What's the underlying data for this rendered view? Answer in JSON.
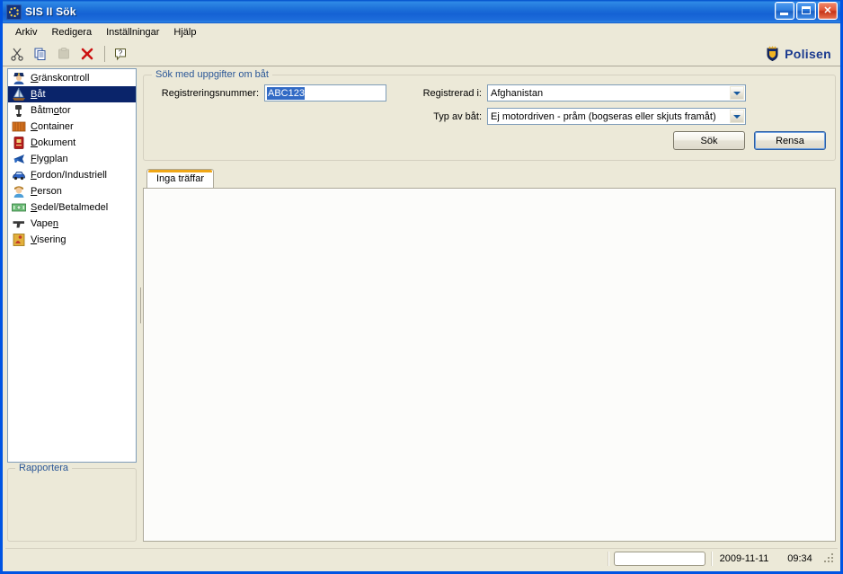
{
  "window": {
    "title": "SIS II Sök",
    "icon": "eu-stars-icon",
    "buttons": {
      "minimize": "minimize-button",
      "maximize": "maximize-button",
      "close": "close-button"
    }
  },
  "menubar": {
    "items": [
      {
        "label": "Arkiv"
      },
      {
        "label": "Redigera"
      },
      {
        "label": "Inställningar"
      },
      {
        "label": "Hjälp"
      }
    ]
  },
  "toolbar": {
    "buttons": [
      {
        "name": "cut-icon",
        "enabled": true
      },
      {
        "name": "copy-icon",
        "enabled": true
      },
      {
        "name": "paste-icon",
        "enabled": false
      },
      {
        "name": "delete-icon",
        "enabled": true
      },
      {
        "name": "help-icon",
        "enabled": true
      }
    ],
    "brand": {
      "text": "Polisen",
      "icon": "police-crest-icon",
      "color": "#1a3a8f"
    }
  },
  "sidebar": {
    "items": [
      {
        "label": "Gränskontroll",
        "accel": "G",
        "icon": "police-officer-icon",
        "selected": false
      },
      {
        "label": "Båt",
        "accel": "B",
        "icon": "sailboat-icon",
        "selected": true
      },
      {
        "label": "Båtmotor",
        "accel": "o",
        "icon": "boat-engine-icon",
        "selected": false
      },
      {
        "label": "Container",
        "accel": "C",
        "icon": "container-icon",
        "selected": false
      },
      {
        "label": "Dokument",
        "accel": "D",
        "icon": "document-icon",
        "selected": false
      },
      {
        "label": "Flygplan",
        "accel": "F",
        "icon": "airplane-icon",
        "selected": false
      },
      {
        "label": "Fordon/Industriell",
        "accel": "F",
        "icon": "car-icon",
        "selected": false
      },
      {
        "label": "Person",
        "accel": "P",
        "icon": "person-icon",
        "selected": false
      },
      {
        "label": "Sedel/Betalmedel",
        "accel": "S",
        "icon": "banknote-icon",
        "selected": false
      },
      {
        "label": "Vapen",
        "accel": "n",
        "icon": "pistol-icon",
        "selected": false
      },
      {
        "label": "Visering",
        "accel": "V",
        "icon": "visa-icon",
        "selected": false
      }
    ],
    "report_box": {
      "legend": "Rapportera"
    }
  },
  "search_panel": {
    "legend": "Sök med uppgifter om båt",
    "fields": {
      "registration_number": {
        "label": "Registreringsnummer:",
        "value": "ABC123",
        "selected": true
      },
      "registered_in": {
        "label": "Registrerad i:",
        "value": "Afghanistan"
      },
      "boat_type": {
        "label": "Typ av båt:",
        "value": "Ej motordriven - pråm (bogseras eller skjuts framåt)"
      }
    },
    "buttons": {
      "search": "Sök",
      "clear": "Rensa",
      "focused": "Rensa"
    }
  },
  "results": {
    "tabs": [
      {
        "label": "Inga träffar",
        "active": true
      }
    ],
    "content": ""
  },
  "statusbar": {
    "message": "",
    "progress": "",
    "date": "2009-11-11",
    "time": "09:34"
  },
  "colors": {
    "title_blue": "#0054e3",
    "face": "#ece9d8",
    "selection": "#0a246a",
    "legend_blue": "#2b5797",
    "tab_accent": "#f0a716",
    "brand": "#1a3a8f"
  }
}
